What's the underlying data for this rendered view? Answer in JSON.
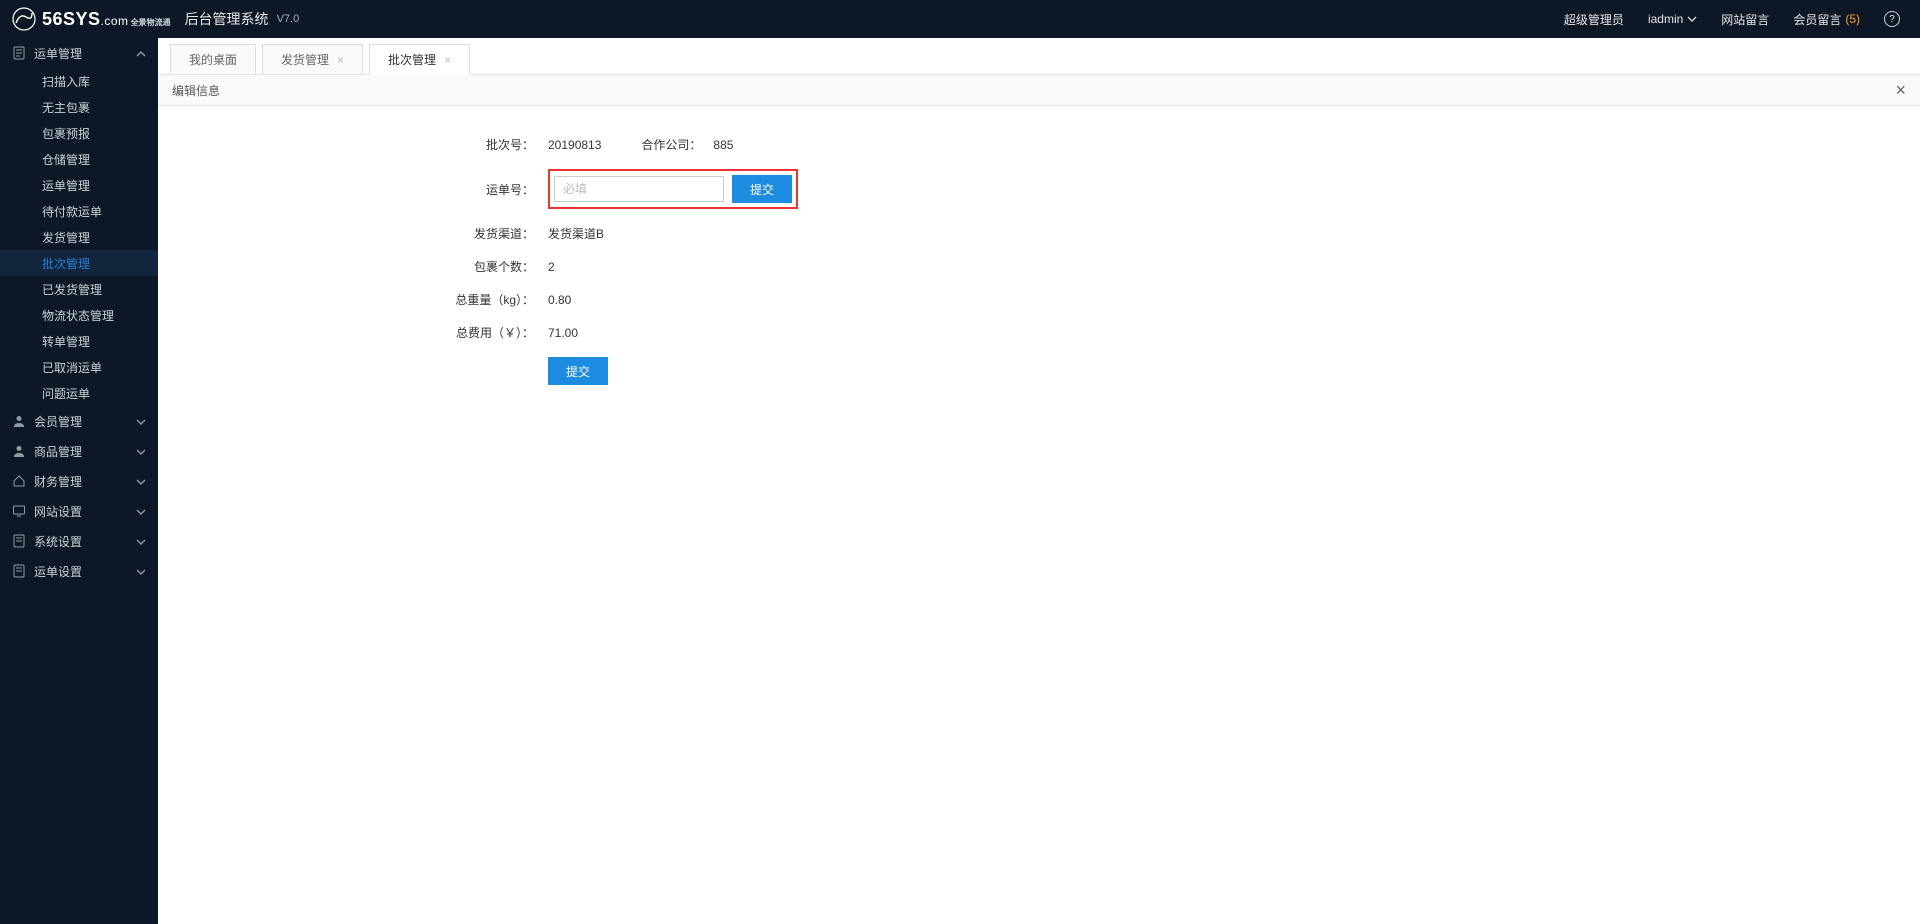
{
  "header": {
    "logo_main": "56SYS",
    "logo_suffix": ".com",
    "logo_sub": "全景物流通",
    "title": "后台管理系统",
    "version": "V7.0",
    "role": "超级管理员",
    "user": "iadmin",
    "site_msg": "网站留言",
    "member_msg": "会员留言",
    "msg_count": "(5)"
  },
  "sidebar": {
    "groups": [
      {
        "label": "运单管理",
        "open": true,
        "items": [
          "扫描入库",
          "无主包裹",
          "包裹预报",
          "仓储管理",
          "运单管理",
          "待付款运单",
          "发货管理",
          "批次管理",
          "已发货管理",
          "物流状态管理",
          "转单管理",
          "已取消运单",
          "问题运单"
        ],
        "active_index": 7
      },
      {
        "label": "会员管理",
        "open": false
      },
      {
        "label": "商品管理",
        "open": false
      },
      {
        "label": "财务管理",
        "open": false
      },
      {
        "label": "网站设置",
        "open": false
      },
      {
        "label": "系统设置",
        "open": false
      },
      {
        "label": "运单设置",
        "open": false
      }
    ]
  },
  "tabs": [
    {
      "label": "我的桌面",
      "closable": false,
      "active": false
    },
    {
      "label": "发货管理",
      "closable": true,
      "active": false
    },
    {
      "label": "批次管理",
      "closable": true,
      "active": true
    }
  ],
  "panel": {
    "title": "编辑信息"
  },
  "form": {
    "batch_no_label": "批次号：",
    "batch_no_value": "20190813",
    "company_label": "合作公司：",
    "company_value": "885",
    "waybill_label": "运单号：",
    "waybill_placeholder": "必填",
    "submit_inline": "提交",
    "channel_label": "发货渠道：",
    "channel_value": "发货渠道B",
    "pkg_count_label": "包裹个数：",
    "pkg_count_value": "2",
    "weight_label": "总重量（kg）：",
    "weight_value": "0.80",
    "cost_label": "总费用（￥）：",
    "cost_value": "71.00",
    "submit_main": "提交"
  },
  "icons": {
    "doc": "doc-icon",
    "user": "user-icon",
    "house": "house-icon",
    "monitor": "monitor-icon"
  }
}
